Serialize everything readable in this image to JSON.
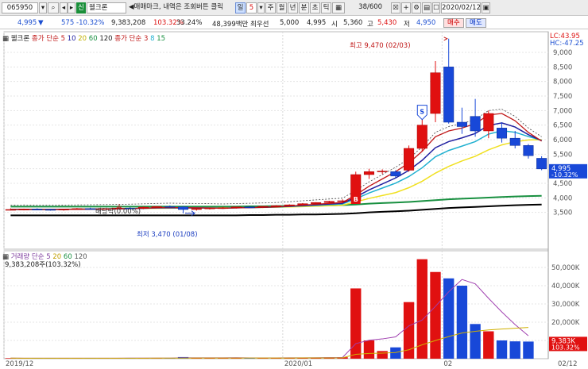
{
  "toolbar": {
    "code": "065950",
    "stock_badge": "신",
    "stock_name": "웰크론",
    "hint": "◀매매마크, 내역은 조회버튼 클릭",
    "period": "일",
    "period_value": "5",
    "periods": [
      "주",
      "월",
      "년",
      "분",
      "초",
      "틱"
    ],
    "count": "38",
    "count_total": "/600",
    "date": "2020/02/12"
  },
  "quote": {
    "price": "4,995",
    "change": "575",
    "change_pct": "-10.32%",
    "volume": "9,383,208",
    "vol_pct": "103.32%",
    "turnover_pct": "33.24%",
    "amount": "48,399백만",
    "best_label": "최우선",
    "best_ask": "5,000",
    "best_bid": "4,995",
    "open_label": "시",
    "open": "5,360",
    "high_label": "고",
    "high": "5,430",
    "low_label": "저",
    "low": "4,950",
    "buy": "매수",
    "sell": "매도"
  },
  "price_legend": {
    "name": "웰크론",
    "ma_label": "종가 단순",
    "ma_periods": [
      "5",
      "10",
      "20",
      "60",
      "120"
    ],
    "ma_colors": [
      "#c01818",
      "#2020a0",
      "#20b0d0",
      "#f0e020",
      "#189040",
      "#000000"
    ],
    "ma2_label": "종가 단순",
    "ma2_periods": [
      "3",
      "8",
      "15"
    ]
  },
  "price_axis": {
    "lc": "LC:43.95",
    "hc": "HC:-47.25",
    "ticks": [
      "9,000",
      "8,500",
      "8,000",
      "7,500",
      "7,000",
      "6,500",
      "6,000",
      "5,500",
      "5,000",
      "4,500",
      "4,000",
      "3,500"
    ],
    "last": "4,995",
    "last_pct": "-10.32%"
  },
  "annotations": {
    "high": "최고 9,470 (02/03)",
    "low": "최저 3,470 (01/08)",
    "dividend": "배당락(0.00%)",
    "buy_mark": "B",
    "sell_mark": "S"
  },
  "volume_legend": {
    "label": "거래량",
    "ma_label": "단순",
    "periods": [
      "5",
      "20",
      "60",
      "120"
    ],
    "value": "9,383,208주(103.32%)"
  },
  "volume_axis": {
    "ticks": [
      "50,000K",
      "40,000K",
      "30,000K",
      "20,000K",
      "10,000K"
    ],
    "last": "9,383K",
    "last_pct": "103.32%"
  },
  "date_axis": {
    "labels": [
      "2019/12",
      "2020/01",
      "02",
      "02/12"
    ]
  },
  "chart_data": {
    "type": "candlestick",
    "candles": [
      [
        3600,
        3640,
        3570,
        3600
      ],
      [
        3600,
        3630,
        3570,
        3610
      ],
      [
        3610,
        3640,
        3580,
        3600
      ],
      [
        3600,
        3620,
        3560,
        3590
      ],
      [
        3590,
        3620,
        3560,
        3610
      ],
      [
        3610,
        3650,
        3590,
        3630
      ],
      [
        3630,
        3660,
        3600,
        3620
      ],
      [
        3620,
        3650,
        3590,
        3630
      ],
      [
        3630,
        3660,
        3600,
        3650
      ],
      [
        3650,
        3680,
        3620,
        3640
      ],
      [
        3640,
        3700,
        3610,
        3680
      ],
      [
        3680,
        3720,
        3650,
        3700
      ],
      [
        3700,
        3740,
        3660,
        3690
      ],
      [
        3690,
        3720,
        3470,
        3600
      ],
      [
        3600,
        3650,
        3560,
        3630
      ],
      [
        3630,
        3670,
        3600,
        3650
      ],
      [
        3650,
        3690,
        3620,
        3660
      ],
      [
        3660,
        3700,
        3630,
        3690
      ],
      [
        3690,
        3720,
        3650,
        3680
      ],
      [
        3680,
        3720,
        3650,
        3710
      ],
      [
        3710,
        3750,
        3680,
        3730
      ],
      [
        3730,
        3780,
        3700,
        3760
      ],
      [
        3760,
        3820,
        3730,
        3800
      ],
      [
        3800,
        3850,
        3770,
        3840
      ],
      [
        3840,
        3900,
        3800,
        3880
      ],
      [
        3880,
        3950,
        3840,
        3900
      ],
      [
        3900,
        4900,
        3890,
        4800
      ],
      [
        4800,
        5000,
        4650,
        4900
      ],
      [
        4900,
        4980,
        4820,
        4920
      ],
      [
        4900,
        4950,
        4700,
        4750
      ],
      [
        4950,
        5800,
        4900,
        5700
      ],
      [
        5700,
        6700,
        5600,
        6500
      ],
      [
        6900,
        8700,
        6600,
        8300
      ],
      [
        8500,
        9470,
        6550,
        6600
      ],
      [
        6600,
        7100,
        6200,
        6450
      ],
      [
        6800,
        7400,
        6100,
        6300
      ],
      [
        6300,
        7000,
        6050,
        6900
      ],
      [
        6400,
        6600,
        5900,
        6050
      ],
      [
        6050,
        6300,
        5700,
        5800
      ],
      [
        5800,
        5850,
        5350,
        5450
      ],
      [
        5360,
        5430,
        4950,
        4995
      ]
    ],
    "volumes": [
      300,
      280,
      260,
      300,
      250,
      310,
      290,
      300,
      320,
      280,
      350,
      400,
      380,
      900,
      450,
      420,
      400,
      500,
      450,
      420,
      470,
      520,
      560,
      650,
      720,
      800,
      38500,
      10000,
      4200,
      6200,
      31000,
      54500,
      47500,
      44000,
      40000,
      19000,
      15000,
      10000,
      9500,
      9383
    ],
    "ma5": [
      3600,
      3605,
      3600,
      3600,
      3602,
      3608,
      3612,
      3618,
      3625,
      3633,
      3645,
      3660,
      3668,
      3662,
      3658,
      3650,
      3640,
      3655,
      3665,
      3675,
      3690,
      3715,
      3750,
      3780,
      3810,
      3840,
      4100,
      4400,
      4650,
      4900,
      5200,
      5600,
      6100,
      6300,
      6400,
      6550,
      6850,
      6900,
      6650,
      6250,
      5950
    ],
    "ma20": [
      3600,
      3600,
      3602,
      3605,
      3608,
      3612,
      3616,
      3620,
      3625,
      3630,
      3636,
      3642,
      3646,
      3648,
      3650,
      3652,
      3655,
      3660,
      3665,
      3672,
      3680,
      3690,
      3700,
      3715,
      3730,
      3750,
      3860,
      3980,
      4080,
      4180,
      4350,
      4570,
      4850,
      5080,
      5270,
      5430,
      5650,
      5820,
      5930,
      5990,
      6000
    ],
    "ma120": [
      3400,
      3400,
      3400,
      3400,
      3400,
      3400,
      3400,
      3400,
      3400,
      3400,
      3400,
      3400,
      3400,
      3400,
      3400,
      3400,
      3400,
      3400,
      3410,
      3410,
      3420,
      3420,
      3430,
      3430,
      3440,
      3450,
      3470,
      3500,
      3520,
      3540,
      3560,
      3590,
      3620,
      3650,
      3670,
      3690,
      3710,
      3730,
      3745,
      3760,
      3770
    ]
  }
}
